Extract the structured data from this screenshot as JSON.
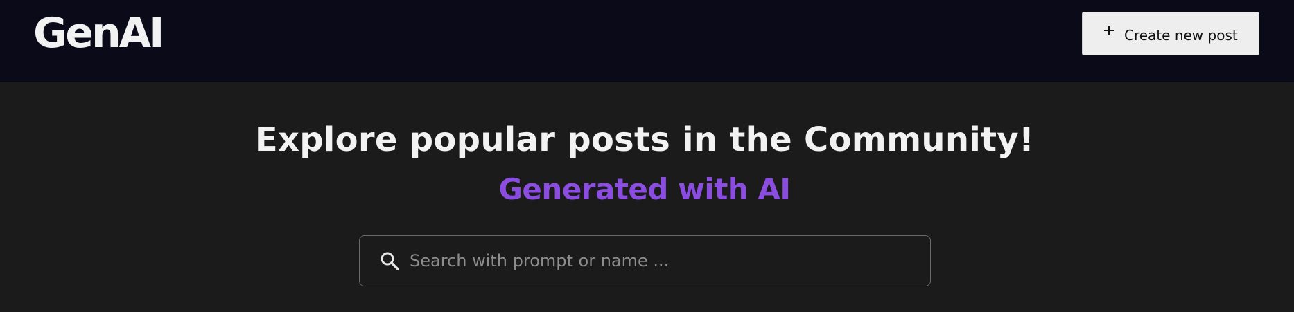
{
  "header": {
    "logo_text": "GenAI",
    "create_button": {
      "icon": "plus-icon",
      "label": "Create new post"
    }
  },
  "main": {
    "headline": "Explore popular posts in the Community!",
    "subheadline": "Generated with AI",
    "search": {
      "icon": "search-icon",
      "placeholder": "Search with prompt or name ...",
      "value": ""
    }
  },
  "colors": {
    "navbar_bg": "#0a0a18",
    "page_bg": "#1b1b1b",
    "accent": "#8a4ddf",
    "button_bg": "#eeeeee"
  }
}
